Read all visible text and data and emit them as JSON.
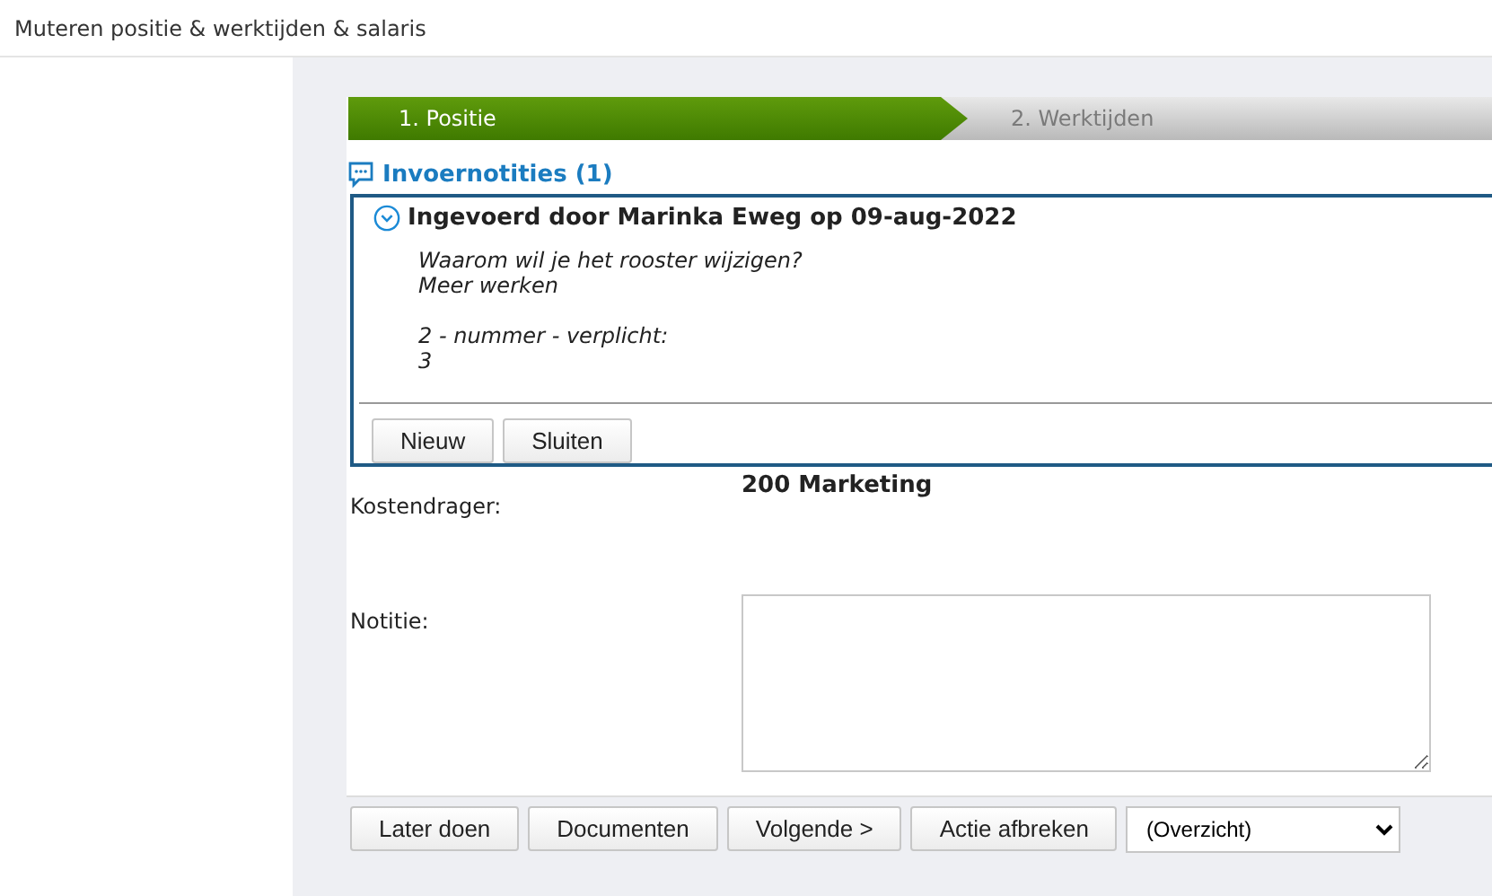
{
  "page_title": "Muteren positie & werktijden & salaris",
  "steps": [
    {
      "label": "1. Positie",
      "selected": true
    },
    {
      "label": "2. Werktijden",
      "selected": false
    }
  ],
  "notes": {
    "title": "Invoernotities (1)",
    "expanded": true,
    "entry_title": "Ingevoerd door Marinka Eweg op 09-aug-2022",
    "paragraphs": [
      [
        "Waarom wil je het rooster wijzigen?",
        "Meer werken"
      ],
      [
        "2 - nummer - verplicht:",
        "3"
      ]
    ],
    "buttons": [
      "Nieuw",
      "Sluiten"
    ]
  },
  "form": [
    {
      "value": "200 Marketing",
      "kind": "text"
    },
    {
      "label": "Kostendrager:",
      "kind": "text"
    },
    {
      "label": "Notitie:",
      "kind": "textarea"
    }
  ],
  "actions": [
    "Later doen",
    "Documenten",
    "Volgende >",
    "Actie afbreken"
  ],
  "view_select": {
    "value": "(Overzicht)"
  }
}
